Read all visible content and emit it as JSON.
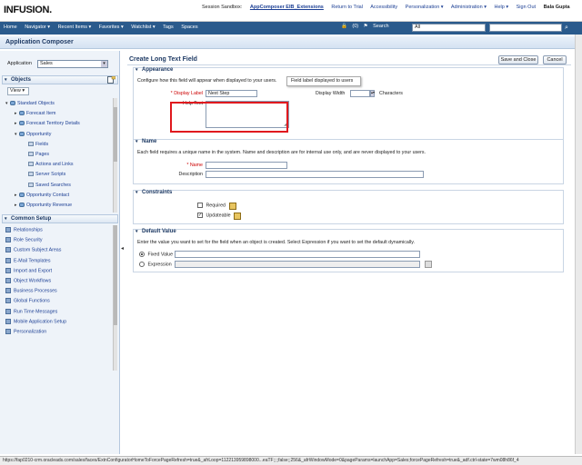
{
  "header": {
    "logo": "INFUSION.",
    "sandbox_label": "Session Sandbox:",
    "sandbox_name": "AppComposer EIB_Extensions",
    "links": [
      "Return to Trial",
      "Accessibility",
      "Personalization ▾",
      "Administration ▾",
      "Help ▾",
      "Sign Out"
    ],
    "user": "Bala Gupta"
  },
  "navbar": {
    "items": [
      "Home",
      "Navigator ▾",
      "Recent Items ▾",
      "Favorites ▾",
      "Watchlist ▾",
      "Tags",
      "Spaces"
    ],
    "watchlist_count": "(0)",
    "search_label": "Search",
    "search_scope": "All",
    "search_value": ""
  },
  "composer": {
    "title": "Application Composer",
    "application_label": "Application",
    "application_value": "Sales",
    "objects_title": "Objects",
    "view_label": "View ▾",
    "tree": [
      {
        "label": "Standard Objects",
        "level": 0,
        "toggle": "▾",
        "icon": "db"
      },
      {
        "label": "Forecast Item",
        "level": 1,
        "toggle": "▸",
        "icon": "db"
      },
      {
        "label": "Forecast Territory Details",
        "level": 1,
        "toggle": "▸",
        "icon": "db"
      },
      {
        "label": "Opportunity",
        "level": 1,
        "toggle": "▾",
        "icon": "db"
      },
      {
        "label": "Fields",
        "level": 2,
        "toggle": "",
        "icon": "pg"
      },
      {
        "label": "Pages",
        "level": 2,
        "toggle": "",
        "icon": "pg"
      },
      {
        "label": "Actions and Links",
        "level": 2,
        "toggle": "",
        "icon": "pg"
      },
      {
        "label": "Server Scripts",
        "level": 2,
        "toggle": "",
        "icon": "pg"
      },
      {
        "label": "Saved Searches",
        "level": 2,
        "toggle": "",
        "icon": "pg"
      },
      {
        "label": "Opportunity Contact",
        "level": 1,
        "toggle": "▸",
        "icon": "db"
      },
      {
        "label": "Opportunity Revenue",
        "level": 1,
        "toggle": "▸",
        "icon": "db"
      }
    ],
    "common_setup_title": "Common Setup",
    "common_items": [
      "Relationships",
      "Role Security",
      "Custom Subject Areas",
      "E-Mail Templates",
      "Import and Export",
      "Object Workflows",
      "Business Processes",
      "Global Functions",
      "Run Time Messages",
      "Mobile Application Setup",
      "Personalization"
    ]
  },
  "main": {
    "title": "Create Long Text Field",
    "save_close": "Save and Close",
    "cancel": "Cancel",
    "appearance": {
      "title": "Appearance",
      "desc": "Configure how this field will appear when displayed to your users.",
      "display_label_label": "* Display Label",
      "display_label_value": "Next Step",
      "tooltip": "Field label displayed to users",
      "display_width_label": "Display Width",
      "display_width_value": "",
      "characters": "Characters",
      "help_text_label": "Help Text",
      "help_text_value": ""
    },
    "name": {
      "title": "Name",
      "desc": "Each field requires a unique name in the system. Name and description are for internal use only, and are never displayed to your users.",
      "name_label": "* Name",
      "name_value": "",
      "description_label": "Description",
      "description_value": ""
    },
    "constraints": {
      "title": "Constraints",
      "required_label": "Required",
      "updateable_label": "Updateable",
      "required_checked": false,
      "updateable_checked": true
    },
    "default_value": {
      "title": "Default Value",
      "desc": "Enter the value you want to set for the field when an object is created. Select Expression if you want to set the default dynamically.",
      "fixed_label": "Fixed Value",
      "expression_label": "Expression",
      "fixed_value": "",
      "expression_value": ""
    }
  },
  "statusbar": {
    "url": "https://fap0210-crm.oracleads.com/sales/faces/ExtnConfiguratorHomeToForcePageRefresh=true&_afrLoop=112213959898000...eaTF;;;;false;;256&_afrWindowMode=0&pageParams=launchApp=Sales;forcePageRefresh=true&_adf.ctrl-state=7wm08h86f_4"
  },
  "colors": {
    "navbar": "#2a5a8c",
    "accent": "#1c3f94",
    "highlight": "#e0191e"
  }
}
